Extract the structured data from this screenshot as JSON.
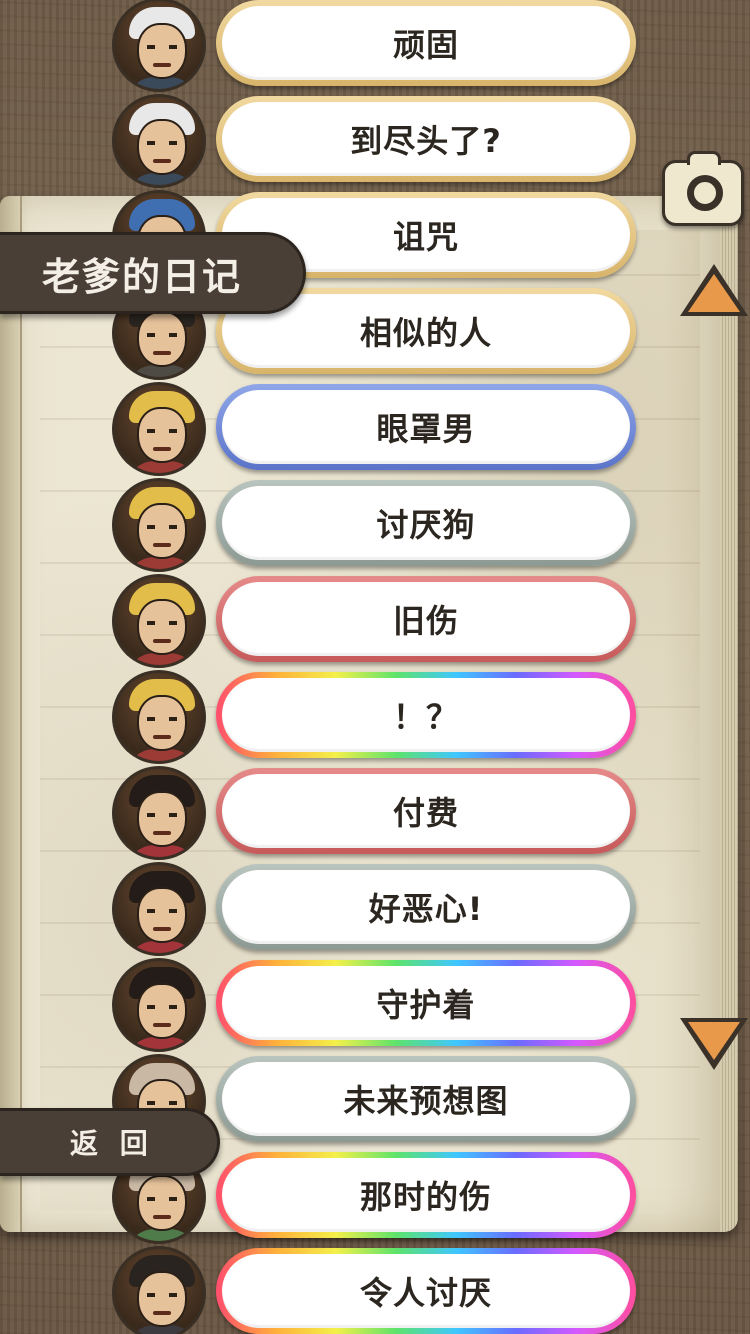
{
  "header": {
    "title": "老爹的日记"
  },
  "footer": {
    "back_label": "返 回"
  },
  "controls": {
    "camera_icon": "camera-icon",
    "scroll_up_icon": "arrow-up-icon",
    "scroll_down_icon": "arrow-down-icon"
  },
  "entries": [
    {
      "label": "顽固",
      "style": "gold",
      "character": "headband-man"
    },
    {
      "label": "到尽头了?",
      "style": "gold",
      "character": "headband-man"
    },
    {
      "label": "诅咒",
      "style": "gold",
      "character": "bandana-boy"
    },
    {
      "label": "相似的人",
      "style": "gold",
      "character": "pale-man"
    },
    {
      "label": "眼罩男",
      "style": "blue",
      "character": "old-man"
    },
    {
      "label": "讨厌狗",
      "style": "gray",
      "character": "old-man"
    },
    {
      "label": "旧伤",
      "style": "red",
      "character": "old-man"
    },
    {
      "label": "！？",
      "style": "rainbow",
      "character": "old-man"
    },
    {
      "label": "付费",
      "style": "red",
      "character": "geisha"
    },
    {
      "label": "好恶心!",
      "style": "gray",
      "character": "geisha"
    },
    {
      "label": "守护着",
      "style": "rainbow",
      "character": "geisha"
    },
    {
      "label": "未来预想图",
      "style": "gray",
      "character": "smiling-man"
    },
    {
      "label": "那时的伤",
      "style": "rainbow",
      "character": "smiling-man"
    },
    {
      "label": "令人讨厌",
      "style": "rainbow",
      "character": "samurai"
    }
  ]
}
